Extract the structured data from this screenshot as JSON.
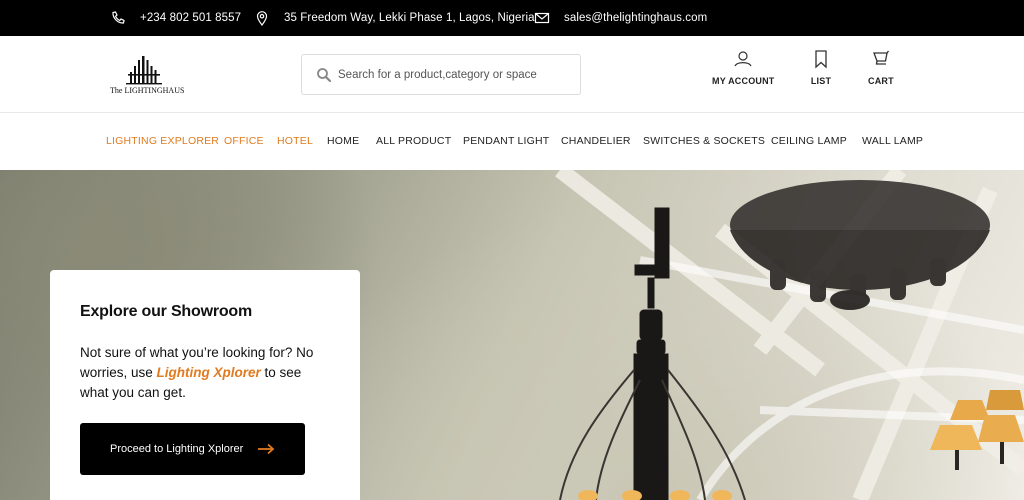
{
  "topbar": {
    "phone": "+234 802 501 8557",
    "address": "35 Freedom Way, Lekki Phase 1, Lagos, Nigeria",
    "email": "sales@thelightinghaus.com",
    "icons": [
      "phone-icon",
      "location-pin-icon",
      "mail-icon"
    ]
  },
  "header": {
    "logo_text": "The LIGHTINGHAUS",
    "search_placeholder": "Search for a product,category or space",
    "my_account": "MY ACCOUNT",
    "list": "LIST",
    "cart": "CART"
  },
  "nav": {
    "items": [
      {
        "label": "LIGHTING EXPLORER",
        "highlight": true
      },
      {
        "label": "OFFICE",
        "highlight": true
      },
      {
        "label": "HOTEL",
        "highlight": true
      },
      {
        "label": "HOME",
        "highlight": false
      },
      {
        "label": "ALL PRODUCT",
        "highlight": false
      },
      {
        "label": "PENDANT LIGHT",
        "highlight": false
      },
      {
        "label": "CHANDELIER",
        "highlight": false
      },
      {
        "label": "SWITCHES & SOCKETS",
        "highlight": false
      },
      {
        "label": "CEILING LAMP",
        "highlight": false
      },
      {
        "label": "WALL LAMP",
        "highlight": false
      }
    ]
  },
  "hero": {
    "card_title": "Explore our Showroom",
    "card_text_before": "Not sure of what you’re looking for? No worries, use ",
    "card_link": "Lighting Xplorer",
    "card_text_after": " to see what you can get.",
    "button_label": "Proceed to Lighting Xplorer"
  },
  "colors": {
    "accent": "#e07b1f",
    "topbar_bg": "#000000",
    "button_bg": "#000000"
  }
}
